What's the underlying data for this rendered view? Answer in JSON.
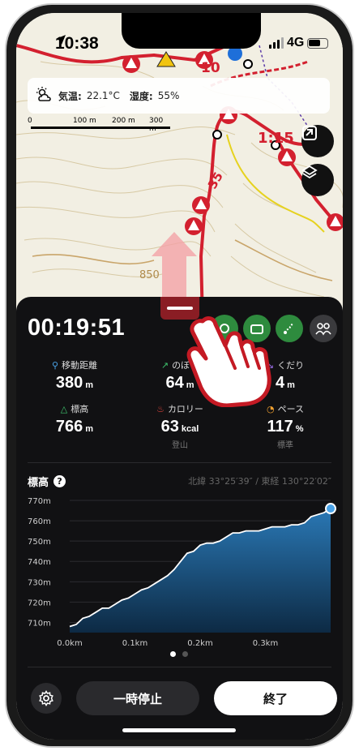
{
  "status": {
    "time": "10:38",
    "network": "4G"
  },
  "weather": {
    "temp_label": "気温:",
    "temp_value": "22.1°C",
    "humidity_label": "湿度:",
    "humidity_value": "55%"
  },
  "scale": {
    "ticks": [
      "0",
      "100 m",
      "200 m",
      "300 m"
    ]
  },
  "map_labels": {
    "segment_time": "1:15",
    "segment_dist": "35",
    "contour_elev": "850"
  },
  "activity": {
    "elapsed": "00:19:51",
    "stats": [
      {
        "label": "移動距離",
        "value": "380",
        "unit": "m",
        "sub": ""
      },
      {
        "label": "のぼり",
        "value": "64",
        "unit": "m",
        "sub": ""
      },
      {
        "label": "くだり",
        "value": "4",
        "unit": "m",
        "sub": ""
      },
      {
        "label": "標高",
        "value": "766",
        "unit": "m",
        "sub": ""
      },
      {
        "label": "カロリー",
        "value": "63",
        "unit": "kcal",
        "sub": "登山"
      },
      {
        "label": "ペース",
        "value": "117",
        "unit": "%",
        "sub": "標準"
      }
    ]
  },
  "elevation": {
    "title": "標高",
    "help": "?",
    "coords": "北緯 33°25′39″ / 東経 130°22′02″"
  },
  "chart_data": {
    "type": "area",
    "title": "標高",
    "xlabel": "",
    "ylabel": "",
    "x_ticks": [
      "0.0km",
      "0.1km",
      "0.2km",
      "0.3km"
    ],
    "y_ticks": [
      "770m",
      "760m",
      "750m",
      "740m",
      "730m",
      "720m",
      "710m"
    ],
    "ylim": [
      705,
      772
    ],
    "xlim": [
      0,
      0.4
    ],
    "grid": true,
    "series": [
      {
        "x": [
          0.0,
          0.01,
          0.02,
          0.03,
          0.04,
          0.05,
          0.06,
          0.07,
          0.08,
          0.09,
          0.1,
          0.11,
          0.12,
          0.13,
          0.14,
          0.15,
          0.16,
          0.17,
          0.18,
          0.19,
          0.2,
          0.21,
          0.22,
          0.23,
          0.24,
          0.25,
          0.26,
          0.27,
          0.28,
          0.29,
          0.3,
          0.31,
          0.32,
          0.33,
          0.34,
          0.35,
          0.36,
          0.37,
          0.38,
          0.39,
          0.4
        ],
        "values": [
          708,
          709,
          712,
          713,
          715,
          717,
          717,
          719,
          721,
          722,
          724,
          726,
          727,
          729,
          731,
          733,
          736,
          740,
          744,
          745,
          748,
          749,
          749,
          750,
          752,
          754,
          754,
          755,
          755,
          755,
          756,
          757,
          757,
          757,
          758,
          758,
          759,
          762,
          763,
          764,
          766
        ]
      }
    ]
  },
  "pager": {
    "count": 2,
    "active": 0
  },
  "controls": {
    "pause_label": "一時停止",
    "finish_label": "終了"
  },
  "colors": {
    "panel": "#111113",
    "accent_red": "#d3202f",
    "chart_fill": "#1f5f8f",
    "chart_point": "#4aa3e8",
    "green": "#2e8b3e"
  }
}
